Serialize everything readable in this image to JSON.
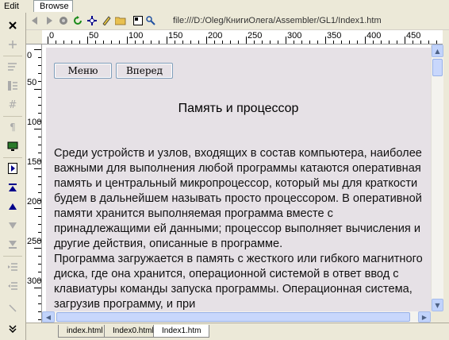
{
  "tabs": {
    "edit": "Edit",
    "browse": "Browse"
  },
  "toolbar": {
    "url": "file:///D:/Oleg/КнигиОлега/Assembler/GL1/Index1.htm",
    "icons": [
      "back-icon",
      "forward-icon",
      "stop-icon",
      "refresh-icon",
      "move-icon",
      "edit-pencil-icon",
      "open-folder-icon",
      "page-properties-icon",
      "find-icon"
    ]
  },
  "ruler": {
    "top_labels": [
      "0",
      "50",
      "100",
      "150",
      "200",
      "250",
      "300",
      "350",
      "400",
      "450"
    ],
    "left_labels": [
      "0",
      "50",
      "100",
      "150",
      "200",
      "250",
      "300"
    ]
  },
  "page": {
    "buttons": {
      "menu": "Меню",
      "next": "Вперед"
    },
    "heading": "Память и процессор",
    "paragraphs": [
      "Среди устройств и узлов, входящих в состав компьютера, наиболее важными для выполнения любой программы катаются оперативная память и центральный микропроцессор, который мы для краткости будем в дальнейшем называть просто процессором. В оперативной памяти хранится выполняемая программа вместе с принадлежащими ей данными; процессор выполняет вычисления и другие действия, описанные в программе.",
      "Программа загружается в память с жесткого или гибкого магнитного диска, где она хранится, операционной системой в ответ ввод с клавиатуры команды запуска программы. Операционная система, загрузив программу, и при"
    ]
  },
  "file_tabs": [
    "index.html",
    "Index0.html",
    "Index1.htm"
  ],
  "colors": {
    "page_bg": "#e6e1e6",
    "chrome_bg": "#ece9d8",
    "scroll_accent": "#c1d3fb"
  }
}
